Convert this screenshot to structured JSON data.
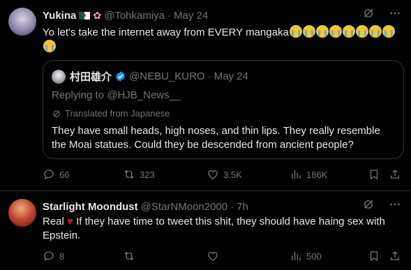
{
  "tweets": [
    {
      "name": "Yukina",
      "handle": "@Tohkamiya",
      "dot": "·",
      "date": "May 24",
      "text": "Yo let's take the internet away from EVERY mangaka",
      "emoji_count": 9,
      "quote": {
        "name": "村田雄介",
        "handle": "@NEBU_KURO",
        "dot": "·",
        "date": "May 24",
        "replying": "Replying to @HJB_News__",
        "translated": "Translated from Japanese",
        "text": "They have small heads, high noses, and thin lips. They really resemble the Moai statues. Could they be descended from ancient people?"
      },
      "actions": {
        "replies": "66",
        "retweets": "323",
        "likes": "3.5K",
        "views": "186K"
      }
    },
    {
      "name": "Starlight Moondust",
      "handle": "@StarNMoon2000",
      "dot": "·",
      "date": "7h",
      "text_pre": "Real",
      "text_post": "If they have time to tweet this shit, they should have haing sex with Epstein.",
      "actions": {
        "replies": "8",
        "retweets": "",
        "likes": "",
        "views": "500"
      }
    }
  ],
  "icons": [
    "grok-icon",
    "more-icon",
    "reply-icon",
    "retweet-icon",
    "like-icon",
    "views-icon",
    "bookmark-icon",
    "share-icon",
    "translate-icon",
    "verified-icon",
    "broken-heart-emoji",
    "crying-emoji"
  ],
  "colors": {
    "background": "#000000",
    "text": "#e7e9ea",
    "muted": "#71767b",
    "border": "#2f3336",
    "verified": "#1d9bf0"
  }
}
